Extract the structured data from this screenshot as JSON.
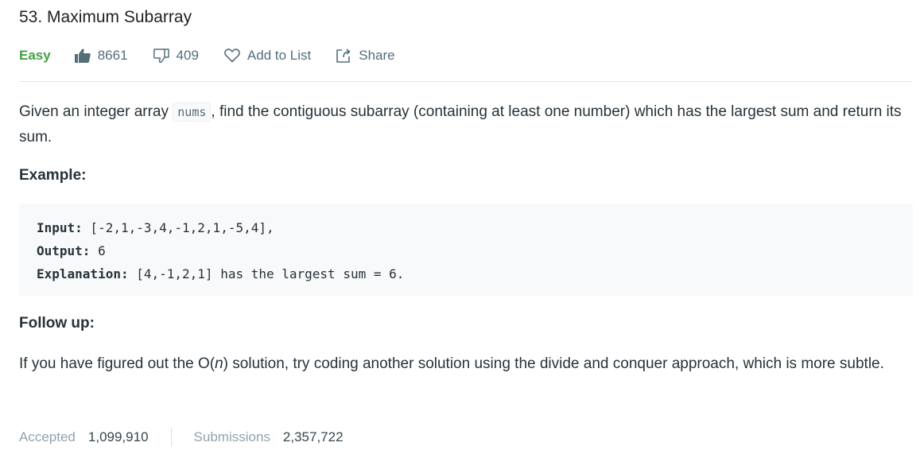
{
  "problem": {
    "title": "53. Maximum Subarray",
    "difficulty": "Easy",
    "likes": "8661",
    "dislikes": "409",
    "add_to_list_label": "Add to List",
    "share_label": "Share"
  },
  "description": {
    "part1": "Given an integer array ",
    "code": "nums",
    "part2": ", find the contiguous subarray (containing at least one number) which has the largest sum and return its sum."
  },
  "example": {
    "heading": "Example:",
    "input_label": "Input:",
    "input_value": " [-2,1,-3,4,-1,2,1,-5,4],",
    "output_label": "Output:",
    "output_value": " 6",
    "explanation_label": "Explanation:",
    "explanation_value": " [4,-1,2,1] has the largest sum = 6."
  },
  "followup": {
    "heading": "Follow up:",
    "text_before": "If you have figured out the O(",
    "text_italic": "n",
    "text_after": ") solution, try coding another solution using the divide and conquer approach, which is more subtle."
  },
  "stats": {
    "accepted_label": "Accepted",
    "accepted_value": "1,099,910",
    "submissions_label": "Submissions",
    "submissions_value": "2,357,722"
  },
  "colors": {
    "difficulty_easy": "#43a047",
    "text": "#263238",
    "muted": "#546e7a",
    "code_bg": "#f7f9fa"
  },
  "icons": {
    "like": "thumbs-up-icon",
    "dislike": "thumbs-down-icon",
    "favorite": "heart-icon",
    "share": "share-icon"
  }
}
